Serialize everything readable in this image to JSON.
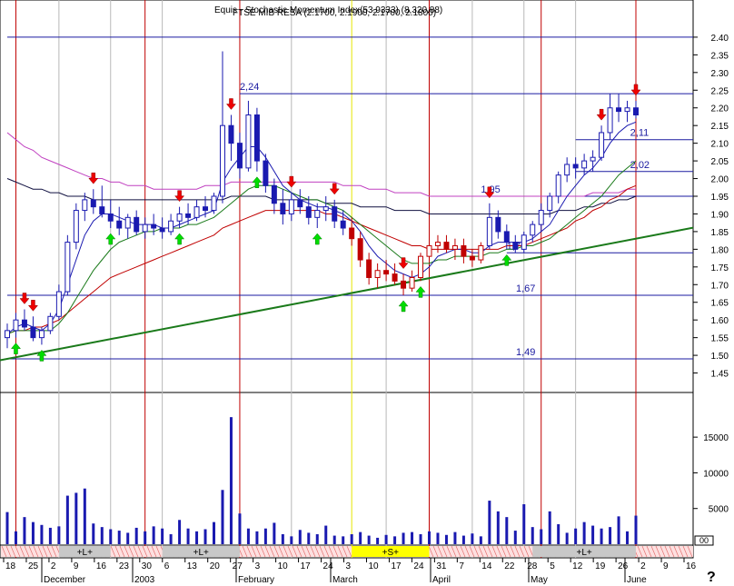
{
  "header": {
    "line1": "Equis - Stochastic Momentum Index(53.9333) (8,320.88)",
    "line2": "FTSE MIB RESA (2.1700, 2.1900, 2.1700, 2.1800)"
  },
  "help_glyph": "?",
  "chart_data": [
    {
      "type": "candlestick",
      "panel": "price",
      "ylim": [
        1.4,
        2.5
      ],
      "yticks": [
        "2.40",
        "2.35",
        "2.30",
        "2.25",
        "2.20",
        "2.15",
        "2.10",
        "2.05",
        "2.00",
        "1.95",
        "1.90",
        "1.85",
        "1.80",
        "1.75",
        "1.70",
        "1.65",
        "1.60",
        "1.55",
        "1.50",
        "1.45"
      ],
      "ohlc": [
        [
          1.55,
          1.59,
          1.52,
          1.57
        ],
        [
          1.57,
          1.62,
          1.55,
          1.6
        ],
        [
          1.6,
          1.63,
          1.57,
          1.58
        ],
        [
          1.58,
          1.61,
          1.54,
          1.55
        ],
        [
          1.55,
          1.58,
          1.53,
          1.57
        ],
        [
          1.57,
          1.62,
          1.56,
          1.61
        ],
        [
          1.61,
          1.7,
          1.6,
          1.68
        ],
        [
          1.68,
          1.84,
          1.67,
          1.82
        ],
        [
          1.82,
          1.93,
          1.8,
          1.91
        ],
        [
          1.91,
          1.96,
          1.88,
          1.94
        ],
        [
          1.94,
          1.97,
          1.9,
          1.92
        ],
        [
          1.92,
          1.98,
          1.89,
          1.9
        ],
        [
          1.9,
          1.94,
          1.86,
          1.88
        ],
        [
          1.88,
          1.92,
          1.84,
          1.86
        ],
        [
          1.86,
          1.9,
          1.83,
          1.89
        ],
        [
          1.89,
          1.91,
          1.84,
          1.85
        ],
        [
          1.85,
          1.89,
          1.83,
          1.87
        ],
        [
          1.87,
          1.9,
          1.84,
          1.86
        ],
        [
          1.86,
          1.89,
          1.83,
          1.85
        ],
        [
          1.85,
          1.9,
          1.84,
          1.88
        ],
        [
          1.88,
          1.92,
          1.86,
          1.9
        ],
        [
          1.9,
          1.93,
          1.87,
          1.89
        ],
        [
          1.89,
          1.94,
          1.88,
          1.92
        ],
        [
          1.92,
          1.95,
          1.89,
          1.91
        ],
        [
          1.91,
          1.96,
          1.9,
          1.95
        ],
        [
          1.95,
          2.36,
          1.93,
          2.15
        ],
        [
          2.15,
          2.18,
          2.05,
          2.1
        ],
        [
          2.1,
          2.13,
          2.0,
          2.03
        ],
        [
          2.03,
          2.22,
          2.02,
          2.18
        ],
        [
          2.18,
          2.2,
          2.02,
          2.05
        ],
        [
          2.05,
          2.07,
          1.96,
          1.98
        ],
        [
          1.98,
          2.0,
          1.9,
          1.93
        ],
        [
          1.93,
          1.97,
          1.87,
          1.9
        ],
        [
          1.9,
          1.96,
          1.88,
          1.94
        ],
        [
          1.94,
          1.97,
          1.9,
          1.92
        ],
        [
          1.92,
          1.95,
          1.87,
          1.89
        ],
        [
          1.89,
          1.93,
          1.86,
          1.91
        ],
        [
          1.91,
          1.95,
          1.88,
          1.92
        ],
        [
          1.92,
          1.94,
          1.86,
          1.88
        ],
        [
          1.88,
          1.91,
          1.84,
          1.86
        ],
        [
          1.86,
          1.89,
          1.81,
          1.83
        ],
        [
          1.83,
          1.85,
          1.75,
          1.77
        ],
        [
          1.77,
          1.79,
          1.7,
          1.72
        ],
        [
          1.72,
          1.76,
          1.69,
          1.74
        ],
        [
          1.74,
          1.77,
          1.71,
          1.73
        ],
        [
          1.73,
          1.76,
          1.7,
          1.71
        ],
        [
          1.71,
          1.73,
          1.67,
          1.69
        ],
        [
          1.69,
          1.74,
          1.68,
          1.72
        ],
        [
          1.72,
          1.79,
          1.71,
          1.78
        ],
        [
          1.78,
          1.83,
          1.77,
          1.81
        ],
        [
          1.81,
          1.84,
          1.79,
          1.82
        ],
        [
          1.82,
          1.84,
          1.79,
          1.8
        ],
        [
          1.8,
          1.83,
          1.77,
          1.81
        ],
        [
          1.81,
          1.83,
          1.76,
          1.78
        ],
        [
          1.78,
          1.8,
          1.75,
          1.77
        ],
        [
          1.77,
          1.82,
          1.76,
          1.81
        ],
        [
          1.81,
          1.93,
          1.8,
          1.89
        ],
        [
          1.89,
          1.91,
          1.83,
          1.85
        ],
        [
          1.85,
          1.87,
          1.8,
          1.82
        ],
        [
          1.82,
          1.84,
          1.79,
          1.8
        ],
        [
          1.8,
          1.85,
          1.79,
          1.84
        ],
        [
          1.84,
          1.88,
          1.82,
          1.87
        ],
        [
          1.87,
          1.93,
          1.85,
          1.91
        ],
        [
          1.91,
          1.96,
          1.89,
          1.95
        ],
        [
          1.95,
          2.02,
          1.93,
          2.01
        ],
        [
          2.01,
          2.06,
          1.99,
          2.04
        ],
        [
          2.04,
          2.06,
          2.0,
          2.03
        ],
        [
          2.03,
          2.07,
          2.01,
          2.05
        ],
        [
          2.05,
          2.08,
          2.02,
          2.06
        ],
        [
          2.06,
          2.15,
          2.05,
          2.13
        ],
        [
          2.13,
          2.24,
          2.11,
          2.2
        ],
        [
          2.2,
          2.24,
          2.16,
          2.19
        ],
        [
          2.19,
          2.22,
          2.16,
          2.2
        ],
        [
          2.2,
          2.22,
          2.17,
          2.18
        ]
      ],
      "sma_fast": [
        1.56,
        1.58,
        1.59,
        1.58,
        1.57,
        1.59,
        1.63,
        1.7,
        1.77,
        1.84,
        1.88,
        1.9,
        1.9,
        1.89,
        1.88,
        1.87,
        1.87,
        1.87,
        1.86,
        1.86,
        1.87,
        1.88,
        1.89,
        1.9,
        1.91,
        1.99,
        2.03,
        2.06,
        2.09,
        2.09,
        2.06,
        2.02,
        1.98,
        1.96,
        1.94,
        1.93,
        1.92,
        1.92,
        1.91,
        1.9,
        1.88,
        1.85,
        1.81,
        1.78,
        1.76,
        1.74,
        1.73,
        1.72,
        1.73,
        1.75,
        1.78,
        1.79,
        1.8,
        1.8,
        1.79,
        1.79,
        1.81,
        1.82,
        1.82,
        1.82,
        1.82,
        1.83,
        1.85,
        1.87,
        1.91,
        1.95,
        1.98,
        2.01,
        2.03,
        2.06,
        2.1,
        2.13,
        2.15,
        2.16
      ],
      "sma_mid": [
        1.56,
        1.57,
        1.57,
        1.57,
        1.57,
        1.57,
        1.59,
        1.62,
        1.66,
        1.7,
        1.74,
        1.77,
        1.8,
        1.82,
        1.83,
        1.84,
        1.85,
        1.85,
        1.86,
        1.86,
        1.86,
        1.87,
        1.87,
        1.88,
        1.89,
        1.91,
        1.93,
        1.95,
        1.97,
        1.98,
        1.98,
        1.98,
        1.97,
        1.96,
        1.95,
        1.94,
        1.94,
        1.93,
        1.92,
        1.91,
        1.89,
        1.87,
        1.85,
        1.83,
        1.81,
        1.79,
        1.77,
        1.76,
        1.76,
        1.76,
        1.77,
        1.77,
        1.78,
        1.78,
        1.78,
        1.78,
        1.79,
        1.79,
        1.8,
        1.8,
        1.81,
        1.81,
        1.82,
        1.83,
        1.85,
        1.87,
        1.89,
        1.91,
        1.93,
        1.95,
        1.98,
        2.01,
        2.03,
        2.05
      ],
      "sma_slow": [
        1.56,
        1.57,
        1.57,
        1.58,
        1.58,
        1.59,
        1.6,
        1.62,
        1.64,
        1.66,
        1.68,
        1.7,
        1.72,
        1.73,
        1.74,
        1.75,
        1.76,
        1.77,
        1.78,
        1.79,
        1.8,
        1.81,
        1.82,
        1.83,
        1.84,
        1.86,
        1.87,
        1.88,
        1.89,
        1.9,
        1.91,
        1.91,
        1.91,
        1.91,
        1.91,
        1.91,
        1.91,
        1.9,
        1.9,
        1.89,
        1.88,
        1.87,
        1.86,
        1.85,
        1.84,
        1.83,
        1.82,
        1.81,
        1.81,
        1.8,
        1.8,
        1.8,
        1.8,
        1.8,
        1.8,
        1.8,
        1.8,
        1.8,
        1.81,
        1.81,
        1.81,
        1.82,
        1.83,
        1.84,
        1.85,
        1.86,
        1.88,
        1.89,
        1.91,
        1.92,
        1.94,
        1.95,
        1.97,
        1.98
      ],
      "sma_long": [
        2.13,
        2.11,
        2.09,
        2.08,
        2.06,
        2.05,
        2.04,
        2.03,
        2.02,
        2.01,
        2.0,
        2.0,
        1.99,
        1.99,
        1.98,
        1.98,
        1.98,
        1.97,
        1.97,
        1.97,
        1.97,
        1.97,
        1.97,
        1.98,
        1.98,
        1.98,
        1.99,
        1.99,
        1.99,
        1.99,
        1.99,
        1.99,
        1.99,
        1.99,
        1.99,
        1.99,
        1.99,
        1.99,
        1.99,
        1.98,
        1.98,
        1.98,
        1.97,
        1.97,
        1.97,
        1.96,
        1.96,
        1.96,
        1.96,
        1.95,
        1.95,
        1.95,
        1.95,
        1.95,
        1.95,
        1.95,
        1.95,
        1.95,
        1.95,
        1.95,
        1.95,
        1.95,
        1.95,
        1.95,
        1.95,
        1.95,
        1.95,
        1.95,
        1.96,
        1.96,
        1.96,
        1.96,
        1.97,
        1.97
      ],
      "sma_ref": [
        2.0,
        1.99,
        1.98,
        1.97,
        1.97,
        1.96,
        1.96,
        1.95,
        1.95,
        1.95,
        1.94,
        1.94,
        1.94,
        1.94,
        1.94,
        1.94,
        1.94,
        1.94,
        1.94,
        1.94,
        1.94,
        1.94,
        1.94,
        1.94,
        1.94,
        1.94,
        1.95,
        1.95,
        1.95,
        1.95,
        1.95,
        1.94,
        1.94,
        1.94,
        1.94,
        1.94,
        1.94,
        1.93,
        1.93,
        1.93,
        1.93,
        1.92,
        1.92,
        1.92,
        1.92,
        1.91,
        1.91,
        1.91,
        1.91,
        1.9,
        1.9,
        1.9,
        1.9,
        1.9,
        1.9,
        1.9,
        1.9,
        1.9,
        1.9,
        1.9,
        1.9,
        1.9,
        1.9,
        1.9,
        1.91,
        1.91,
        1.91,
        1.92,
        1.92,
        1.93,
        1.93,
        1.94,
        1.94,
        1.95
      ],
      "trendline": {
        "from": [
          0,
          1.49
        ],
        "to": [
          73,
          1.83
        ],
        "color": "#1a7a1a"
      },
      "hlines": [
        {
          "value": 2.24,
          "label": "2,24",
          "from": 27
        },
        {
          "value": 2.11,
          "label": "2,11",
          "from": 66
        },
        {
          "value": 2.02,
          "label": "2,02",
          "from": 66
        },
        {
          "value": 1.95,
          "label": "1,95",
          "from": 55
        },
        {
          "value": 1.79,
          "label": "1,79",
          "from": 58
        },
        {
          "value": 1.67,
          "label": "1,67",
          "from": 0
        },
        {
          "value": 1.49,
          "label": "1,49",
          "from": 0
        },
        {
          "value": 2.4,
          "label": "",
          "from": 0
        }
      ],
      "buy_arrows": [
        1,
        4,
        12,
        20,
        29,
        36,
        46,
        48,
        58
      ],
      "sell_arrows": [
        2,
        3,
        10,
        20,
        26,
        33,
        38,
        46,
        56,
        69,
        73
      ],
      "vlines_red": [
        1,
        16,
        27,
        49,
        62,
        73
      ],
      "vlines_yellow": [
        40
      ],
      "vlines_gray": [
        6,
        12,
        18,
        33,
        44,
        54,
        60,
        66
      ]
    },
    {
      "type": "bar",
      "panel": "volume",
      "ylim": [
        0,
        21000
      ],
      "yticks": [
        "15000",
        "10000",
        "5000"
      ],
      "values": [
        4500,
        1800,
        3800,
        3100,
        2700,
        2300,
        2500,
        6800,
        7200,
        7800,
        2900,
        2400,
        2100,
        1900,
        1600,
        2300,
        1800,
        2500,
        2200,
        1400,
        3400,
        2200,
        1800,
        2100,
        3100,
        7600,
        17800,
        4300,
        2200,
        1800,
        2200,
        3000,
        1400,
        1100,
        2000,
        1600,
        1400,
        2600,
        1200,
        1100,
        1400,
        1700,
        1200,
        900,
        1300,
        1100,
        1600,
        1700,
        1400,
        1800,
        1600,
        1300,
        1700,
        1200,
        1500,
        1100,
        6100,
        4600,
        3800,
        1900,
        5600,
        2400,
        2100,
        4600,
        2800,
        1600,
        2200,
        3100,
        2600,
        2200,
        2400,
        3900,
        1800,
        4000
      ]
    }
  ],
  "signals": [
    {
      "label": "+L+",
      "start": 6,
      "end": 12,
      "color": "#c8c8c8"
    },
    {
      "label": "+L+",
      "start": 18,
      "end": 27,
      "color": "#c8c8c8"
    },
    {
      "label": "+S+",
      "start": 40,
      "end": 49,
      "color": "#ffff00"
    },
    {
      "label": "+L+",
      "start": 61,
      "end": 73,
      "color": "#c8c8c8"
    }
  ],
  "day_ticks": [
    "18",
    "25",
    "2",
    "9",
    "16",
    "23",
    "30",
    "6",
    "13",
    "20",
    "27",
    "3",
    "10",
    "17",
    "24",
    "3",
    "10",
    "17",
    "24",
    "31",
    "7",
    "14",
    "22",
    "28",
    "5",
    "12",
    "19",
    "26",
    "2",
    "9",
    "16"
  ],
  "month_labels": [
    "December",
    "2003",
    "February",
    "March",
    "April",
    "May",
    "June"
  ],
  "volume_axis_suffix": "00"
}
